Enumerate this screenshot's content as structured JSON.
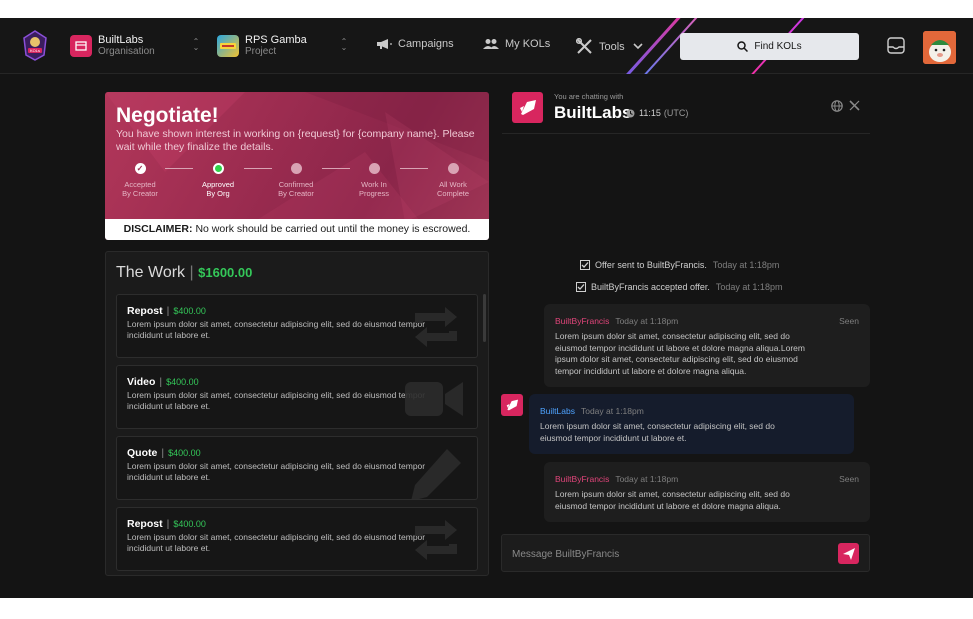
{
  "nav": {
    "organisation": {
      "name": "BuiltLabs",
      "label": "Organisation"
    },
    "project": {
      "name": "RPS Gamba",
      "label": "Project"
    },
    "links": {
      "campaigns": "Campaigns",
      "my_kols": "My KOLs",
      "tools": "Tools"
    },
    "find_kols": "Find KOLs"
  },
  "negotiate": {
    "title": "Negotiate!",
    "text": "You have shown interest in working on {request} for {company name}. Please wait while they finalize the details.",
    "steps": [
      {
        "line1": "Accepted",
        "line2": "By Creator",
        "state": "done"
      },
      {
        "line1": "Approved",
        "line2": "By Org",
        "state": "current"
      },
      {
        "line1": "Confirmed",
        "line2": "By Creator",
        "state": "pending"
      },
      {
        "line1": "Work In",
        "line2": "Progress",
        "state": "pending"
      },
      {
        "line1": "All Work",
        "line2": "Complete",
        "state": "pending"
      }
    ],
    "disclaimer_label": "DISCLAIMER:",
    "disclaimer_text": "No work should be carried out until the money is escrowed."
  },
  "work": {
    "title": "The Work",
    "total": "$1600.00",
    "items": [
      {
        "type": "Repost",
        "price": "$400.00",
        "description": "Lorem ipsum dolor sit amet, consectetur adipiscing elit, sed do eiusmod tempor incididunt ut labore et.",
        "icon": "repost-icon"
      },
      {
        "type": "Video",
        "price": "$400.00",
        "description": "Lorem ipsum dolor sit amet, consectetur adipiscing elit, sed do eiusmod tempor incididunt ut labore et.",
        "icon": "video-camera-icon"
      },
      {
        "type": "Quote",
        "price": "$400.00",
        "description": "Lorem ipsum dolor sit amet, consectetur adipiscing elit, sed do eiusmod tempor incididunt ut labore et.",
        "icon": "pencil-icon"
      },
      {
        "type": "Repost",
        "price": "$400.00",
        "description": "Lorem ipsum dolor sit amet, consectetur adipiscing elit, sed do eiusmod tempor incididunt ut labore et.",
        "icon": "repost-icon"
      }
    ]
  },
  "chat": {
    "subtitle": "You are chatting with",
    "name": "BuiltLabs",
    "time": "11:15",
    "timezone": "(UTC)",
    "system_messages": [
      {
        "text": "Offer sent to BuiltByFrancis.",
        "time": "Today at 1:18pm"
      },
      {
        "text": "BuiltByFrancis accepted offer.",
        "time": "Today at 1:18pm"
      }
    ],
    "messages": [
      {
        "sender": "BuiltByFrancis",
        "time": "Today at 1:18pm",
        "status": "Seen",
        "lines": [
          "Lorem ipsum dolor sit amet, consectetur adipiscing elit, sed do",
          "eiusmod tempor incididunt ut labore et dolore magna aliqua.Lorem",
          "ipsum dolor sit amet, consectetur adipiscing elit, sed do eiusmod",
          "tempor incididunt ut labore et dolore magna aliqua."
        ]
      },
      {
        "sender": "BuiltLabs",
        "time": "Today at 1:18pm",
        "status": "",
        "lines": [
          "Lorem ipsum dolor sit amet, consectetur adipiscing elit, sed do",
          "eiusmod tempor incididunt ut labore et."
        ]
      },
      {
        "sender": "BuiltByFrancis",
        "time": "Today at 1:18pm",
        "status": "Seen",
        "lines": [
          "Lorem ipsum dolor sit amet, consectetur adipiscing elit, sed do",
          "eiusmod tempor incididunt ut labore et dolore magna aliqua."
        ]
      }
    ],
    "input_placeholder": "Message BuiltByFrancis"
  },
  "colors": {
    "accent": "#d8265f",
    "success": "#34c759",
    "other_sender": "#e0457a",
    "own_sender": "#4ea3ff"
  }
}
